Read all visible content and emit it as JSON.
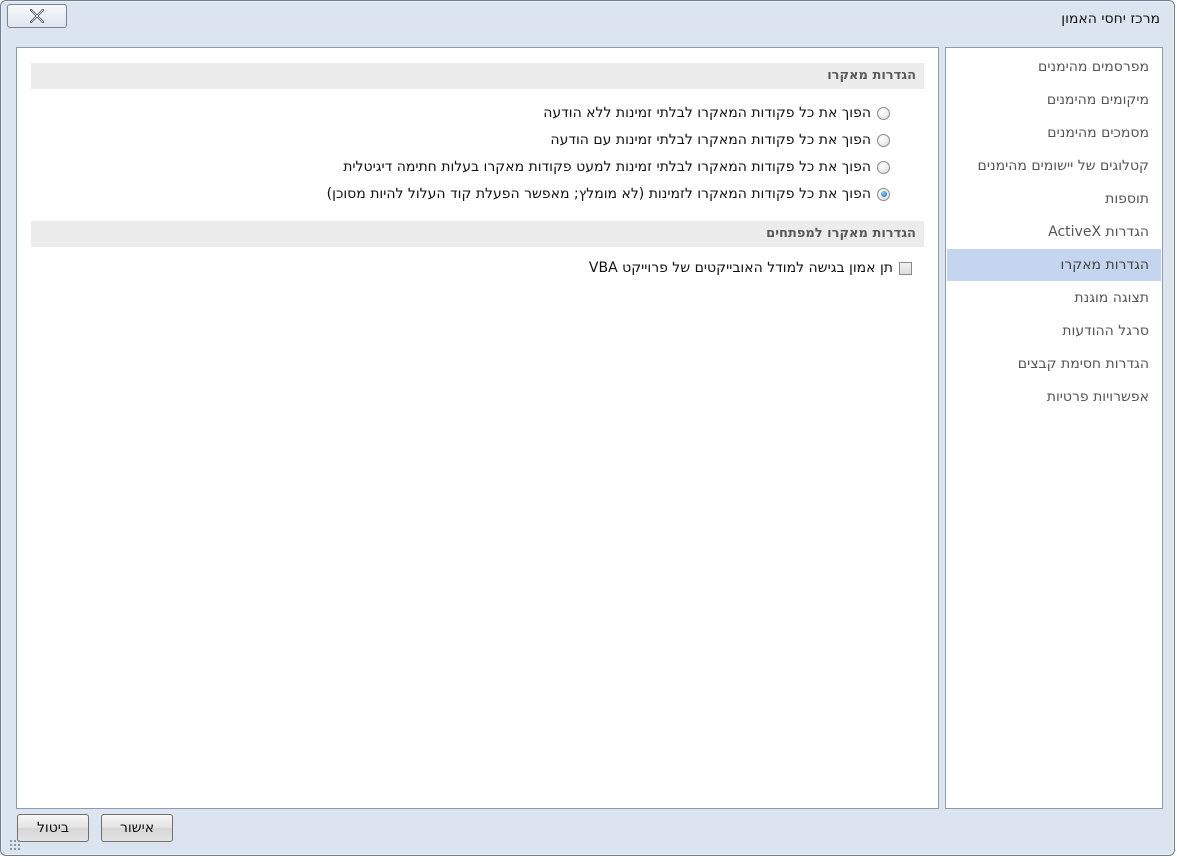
{
  "window": {
    "title": "מרכז יחסי האמון",
    "close_icon": "close-x-icon"
  },
  "sidebar": {
    "items": [
      {
        "label": "מפרסמים מהימנים",
        "selected": false
      },
      {
        "label": "מיקומים מהימנים",
        "selected": false
      },
      {
        "label": "מסמכים מהימנים",
        "selected": false
      },
      {
        "label": "קטלוגים של יישומים מהימנים",
        "selected": false
      },
      {
        "label": "תוספות",
        "selected": false
      },
      {
        "label": "הגדרות ActiveX",
        "selected": false
      },
      {
        "label": "הגדרות מאקרו",
        "selected": true
      },
      {
        "label": "תצוגה מוגנת",
        "selected": false
      },
      {
        "label": "סרגל ההודעות",
        "selected": false
      },
      {
        "label": "הגדרות חסימת קבצים",
        "selected": false
      },
      {
        "label": "אפשרויות פרטיות",
        "selected": false
      }
    ]
  },
  "macro_settings": {
    "header": "הגדרות מאקרו",
    "options": [
      {
        "label": "הפוך את כל פקודות המאקרו לבלתי זמינות ללא הודעה",
        "checked": false
      },
      {
        "label": "הפוך את כל פקודות המאקרו לבלתי זמינות עם הודעה",
        "checked": false
      },
      {
        "label": "הפוך את כל פקודות המאקרו לבלתי זמינות למעט פקודות מאקרו בעלות חתימה דיגיטלית",
        "checked": false
      },
      {
        "label": "הפוך את כל פקודות המאקרו לזמינות (לא מומלץ; מאפשר הפעלת קוד העלול להיות מסוכן)",
        "checked": true
      }
    ]
  },
  "developer_settings": {
    "header": "הגדרות מאקרו למפתחים",
    "trust_vba_label": "תן אמון בגישה למודל האובייקטים של פרוייקט VBA",
    "trust_vba_checked": false
  },
  "footer": {
    "ok_label": "אישור",
    "cancel_label": "ביטול"
  },
  "colors": {
    "window_bg": "#dce5ef",
    "selected_item_bg": "#c5d5ef",
    "section_header_bg": "#ececec",
    "radio_checked": "#1c5fa8"
  }
}
